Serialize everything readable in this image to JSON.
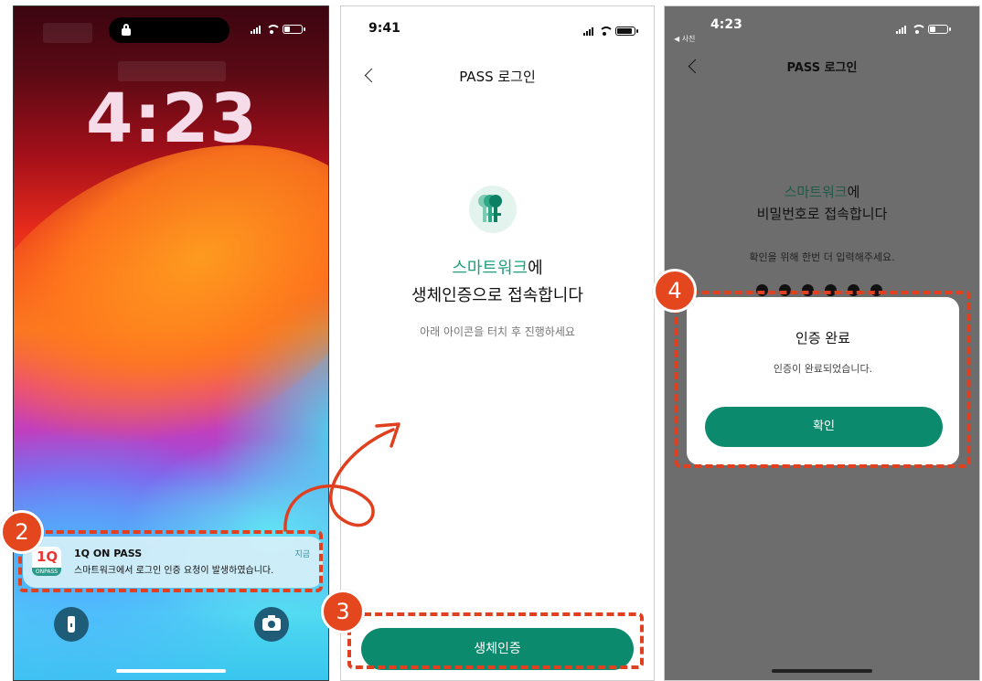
{
  "phone1": {
    "status_time": "4:23",
    "notification": {
      "app_name": "1Q ON PASS",
      "icon_text_top": "1Q",
      "icon_text_bottom": "ONPASS",
      "message": "스마트워크에서 로그인 인증 요청이 발생하였습니다.",
      "time": "지금"
    },
    "icons": [
      "lock-icon",
      "signal-icon",
      "wifi-icon",
      "battery-icon",
      "flashlight-icon",
      "camera-icon"
    ]
  },
  "phone2": {
    "status_time": "9:41",
    "nav_title": "PASS 로그인",
    "heading_highlight": "스마트워크",
    "heading_suffix": "에",
    "heading_line2": "생체인증으로 접속합니다",
    "instruction": "아래 아이콘을 터치 후 진행하세요",
    "cta_label": "생체인증",
    "icons": [
      "back-icon",
      "key-icon"
    ]
  },
  "phone3": {
    "status_time": "4:23",
    "back_app": "◀ 사진",
    "nav_title": "PASS 로그인",
    "heading_highlight": "스마트워크",
    "heading_suffix": "에",
    "heading_line2": "비밀번호로 접속합니다",
    "instruction": "확인을 위해 한번 더 입력해주세요.",
    "dialog": {
      "title": "인증 완료",
      "message": "인증이 완료되었습니다.",
      "confirm_label": "확인"
    }
  },
  "annotations": {
    "step2": "2",
    "step3": "3",
    "step4": "4",
    "accent_color": "#e0401f"
  },
  "colors": {
    "brand_green": "#0c8a6d",
    "highlight_green": "#1aa07e"
  }
}
